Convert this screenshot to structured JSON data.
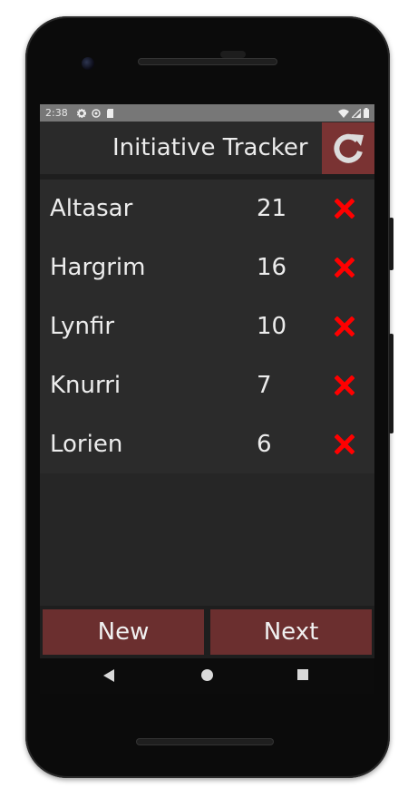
{
  "status_bar": {
    "time": "2:38",
    "left_icons": [
      "gear-icon",
      "sync-icon",
      "sd-card-icon"
    ],
    "right_icons": [
      "wifi-icon",
      "signal-icon",
      "battery-icon"
    ]
  },
  "app_bar": {
    "title": "Initiative Tracker",
    "reset_icon": "refresh-icon",
    "accent_color": "#7a3333"
  },
  "combatants": [
    {
      "name": "Altasar",
      "initiative": "21"
    },
    {
      "name": "Hargrim",
      "initiative": "16"
    },
    {
      "name": "Lynfir",
      "initiative": "10"
    },
    {
      "name": "Knurri",
      "initiative": "7"
    },
    {
      "name": "Lorien",
      "initiative": "6"
    }
  ],
  "remove_icon": "close-x-icon",
  "remove_color": "#ff0000",
  "buttons": {
    "new_label": "New",
    "next_label": "Next",
    "color": "#6b2f2f"
  },
  "nav": {
    "back_icon": "back-triangle-icon",
    "home_icon": "home-circle-icon",
    "recents_icon": "recents-square-icon"
  }
}
